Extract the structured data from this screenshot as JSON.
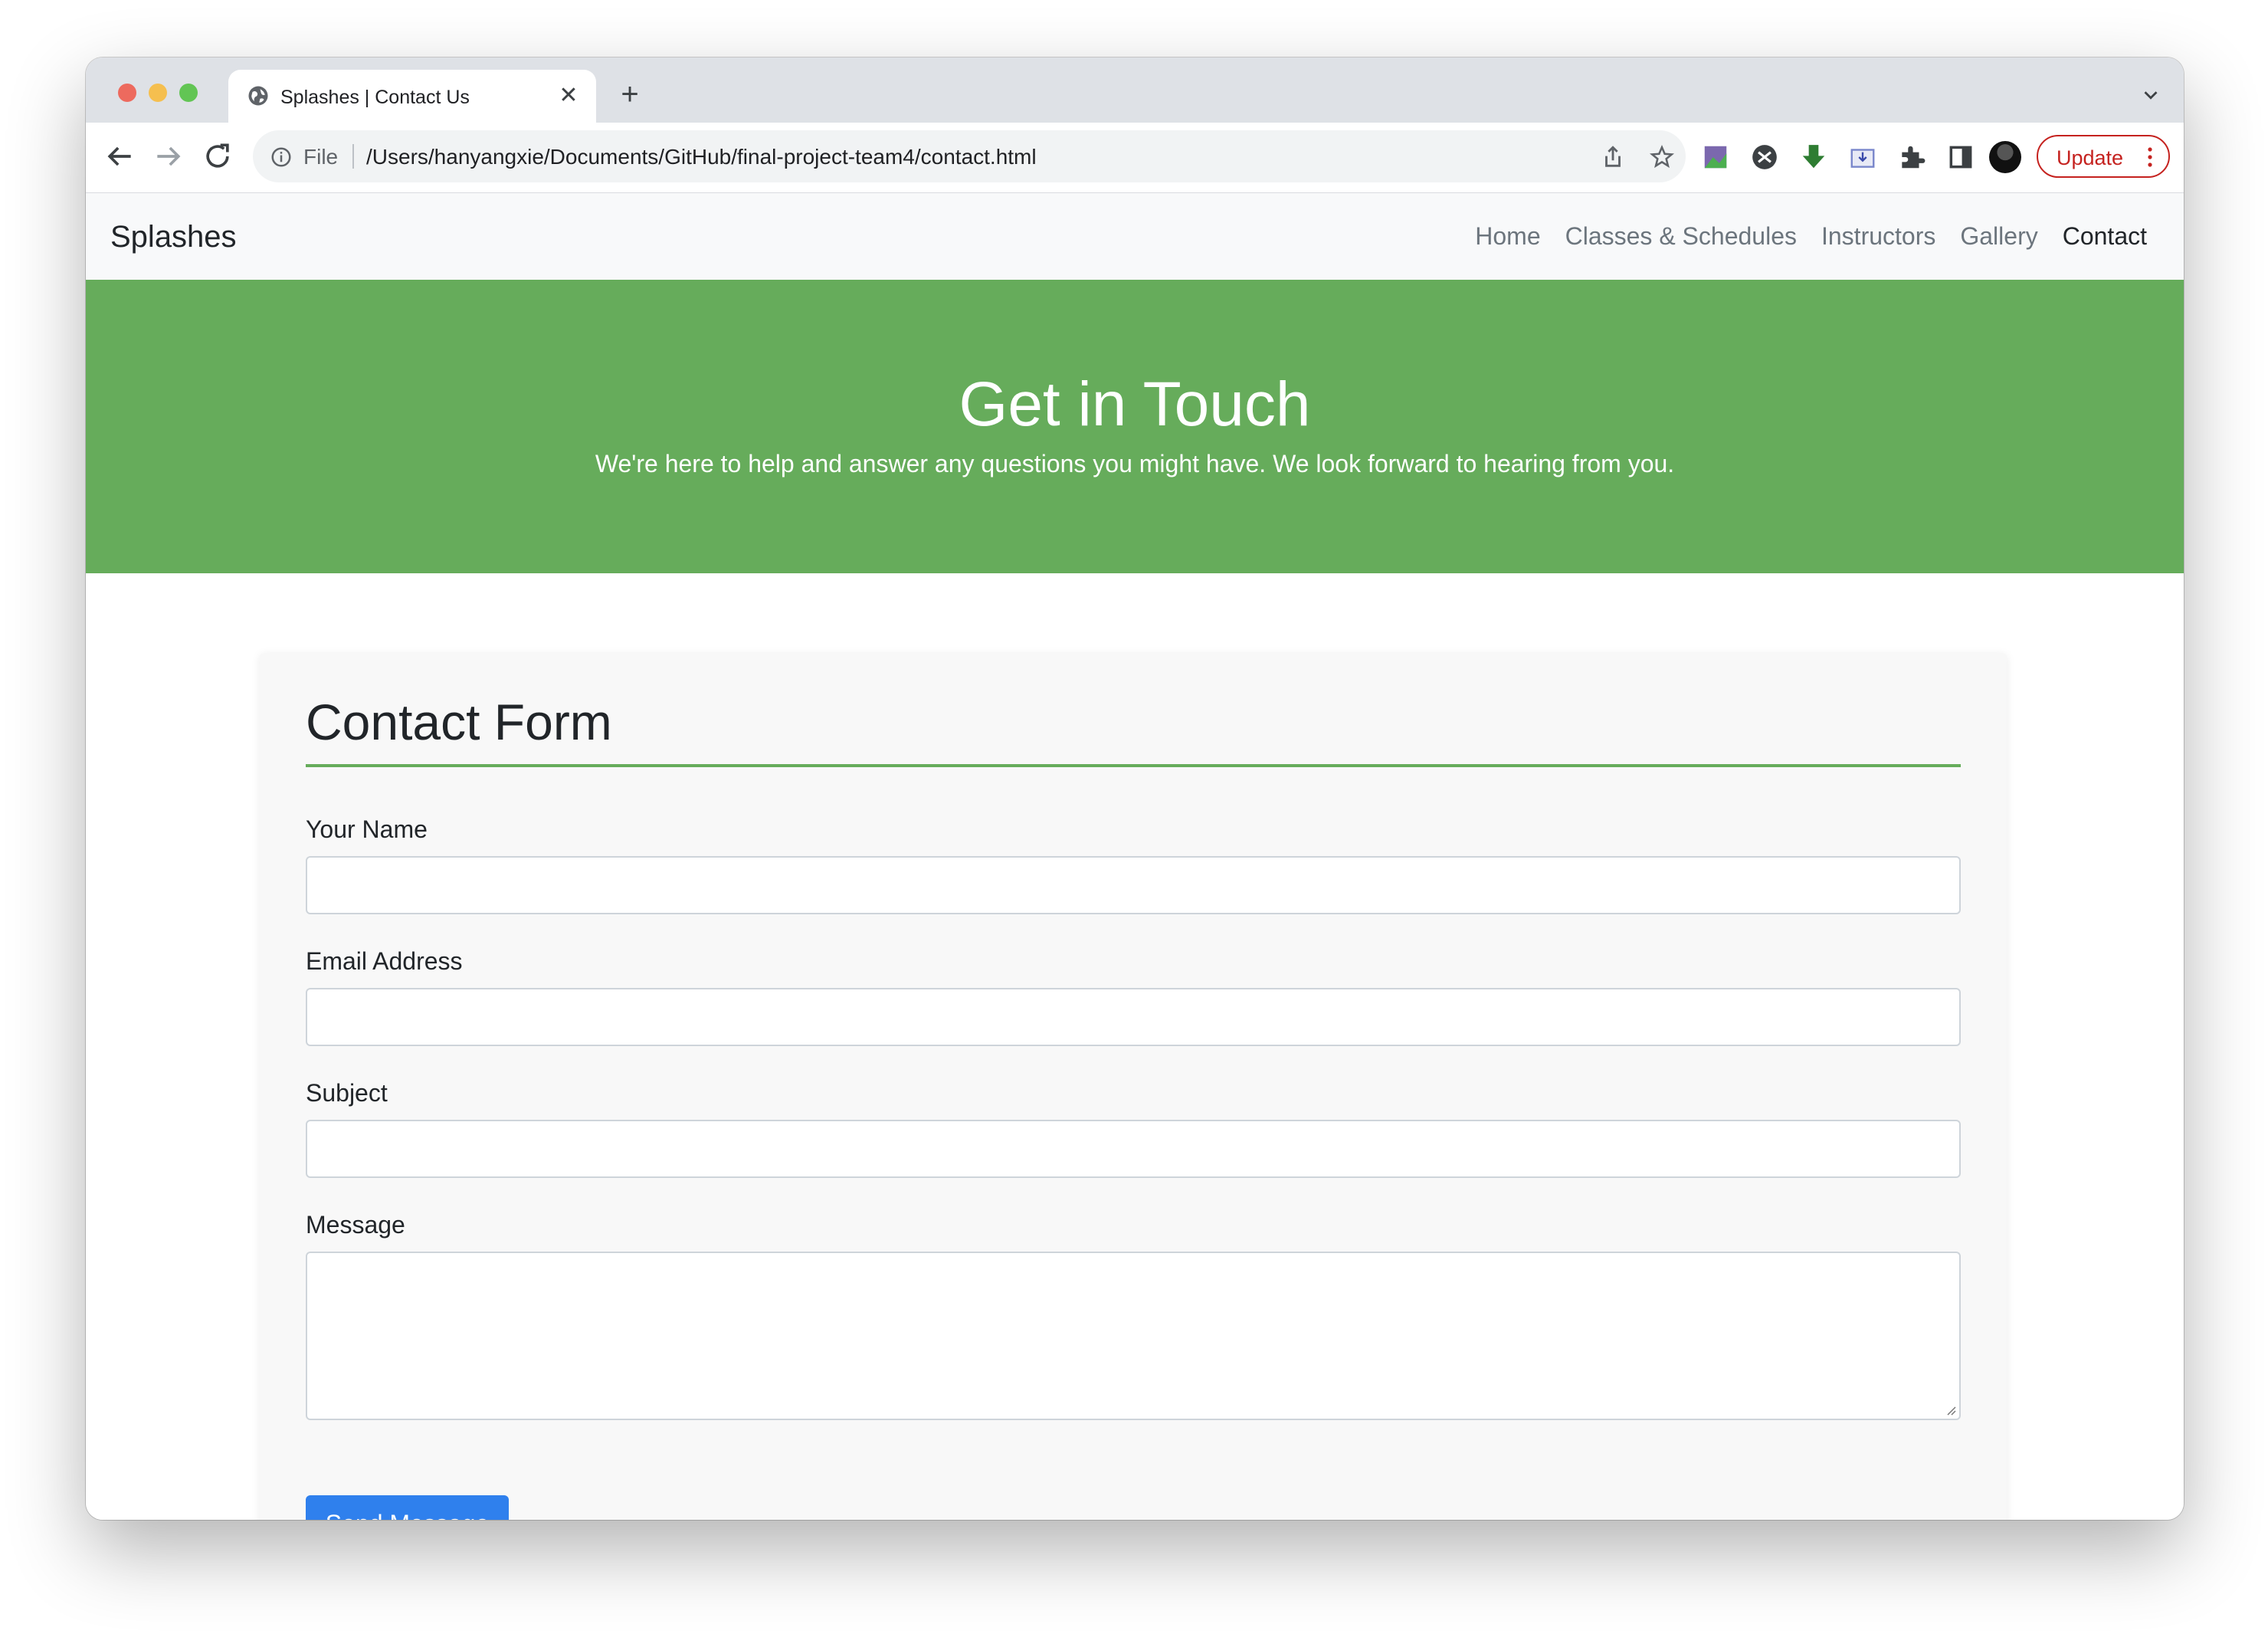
{
  "browser": {
    "tab": {
      "title": "Splashes | Contact Us",
      "close": "✕",
      "favicon": "globe-icon"
    },
    "new_tab": "+",
    "address_bar": {
      "scheme_label": "File",
      "url": "/Users/hanyangxie/Documents/GitHub/final-project-team4/contact.html"
    },
    "update_label": "Update",
    "extensions": [
      "image-extension-icon",
      "sync-extension-icon",
      "download-extension-icon",
      "screenshot-extension-icon",
      "puzzle-extensions-icon",
      "side-panel-icon"
    ]
  },
  "site": {
    "brand": "Splashes",
    "nav": [
      {
        "label": "Home",
        "active": false
      },
      {
        "label": "Classes & Schedules",
        "active": false
      },
      {
        "label": "Instructors",
        "active": false
      },
      {
        "label": "Gallery",
        "active": false
      },
      {
        "label": "Contact",
        "active": true
      }
    ],
    "hero": {
      "title": "Get in Touch",
      "subtitle": "We're here to help and answer any questions you might have. We look forward to hearing from you."
    },
    "form": {
      "title": "Contact Form",
      "fields": [
        {
          "label": "Your Name",
          "value": ""
        },
        {
          "label": "Email Address",
          "value": ""
        },
        {
          "label": "Subject",
          "value": ""
        },
        {
          "label": "Message",
          "value": ""
        }
      ],
      "submit_label": "Send Message"
    }
  },
  "colors": {
    "hero_green": "#66ac5b",
    "button_blue": "#2f80ed",
    "update_red": "#c5221f"
  }
}
